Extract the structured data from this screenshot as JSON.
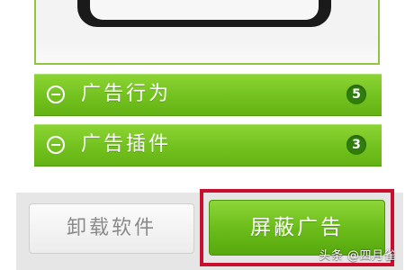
{
  "rows": [
    {
      "label": "广告行为",
      "count": "5"
    },
    {
      "label": "广告插件",
      "count": "3"
    }
  ],
  "buttons": {
    "uninstall_label": "卸载软件",
    "block_ads_label": "屏蔽广告"
  },
  "watermark": {
    "text": "头条 @四月雀"
  },
  "colors": {
    "accent_green": "#72c11e",
    "badge_green": "#2f7d0a",
    "highlight_red": "#c8102e"
  },
  "icons": {
    "row_icon": "collapse-minus-icon"
  }
}
